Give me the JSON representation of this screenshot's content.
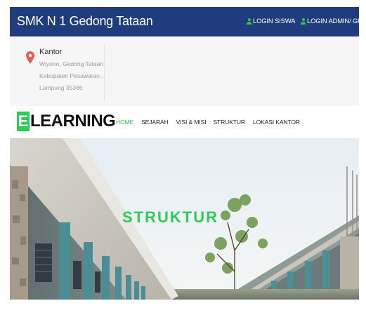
{
  "header": {
    "site_title": "SMK N 1 Gedong Tataan",
    "login_siswa": "LOGIN SISWA",
    "login_admin": "LOGIN ADMIN/ GURU"
  },
  "contact": {
    "icon": "map-pin-icon",
    "label": "Kantor",
    "address_lines": [
      "Wiyono, Gedong Tataan,",
      "Kabupaten Pesawaran ,",
      "Lampung 35366"
    ]
  },
  "logo": {
    "initial": "E",
    "text": "LEARNING"
  },
  "nav": {
    "items": [
      "HOME",
      "SEJARAH",
      "VISI & MISI",
      "STRUKTUR",
      "LOKASI KANTOR"
    ],
    "active": "HOME"
  },
  "hero": {
    "title": "STRUKTUR"
  },
  "colors": {
    "topbar": "#1f3d7d",
    "accent": "#2ecc57",
    "pin": "#e85a4f"
  }
}
